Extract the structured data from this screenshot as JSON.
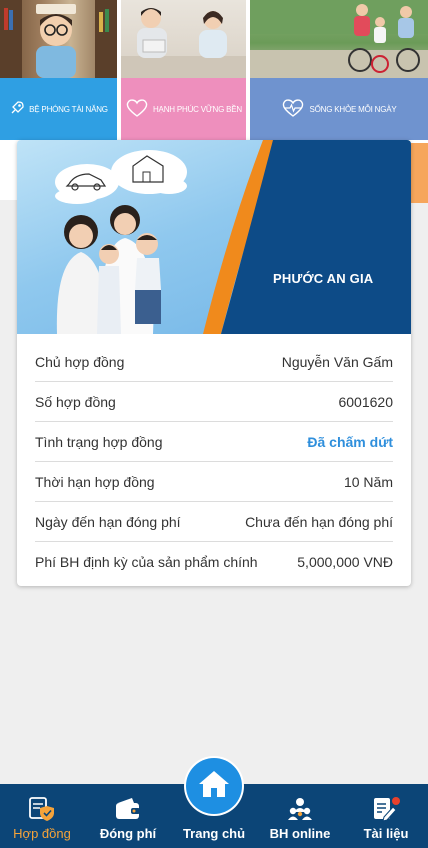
{
  "banners": [
    {
      "label": "BỆ PHÓNG TÀI NĂNG",
      "icon": "rocket-icon",
      "color": "#2f9fe3"
    },
    {
      "label": "HẠNH PHÚC VỮNG BỀN",
      "icon": "heart-icon",
      "color": "#ee8fbd"
    },
    {
      "label": "SỐNG KHỎE MỖI NGÀY",
      "icon": "heart-pulse-icon",
      "color": "#6f93cf"
    }
  ],
  "contract": {
    "product_name": "PHƯỚC AN GIA",
    "rows": [
      {
        "label": "Chủ hợp đồng",
        "value": "Nguyễn Văn Gấm"
      },
      {
        "label": "Số hợp đồng",
        "value": "6001620"
      },
      {
        "label": "Tình trạng hợp đồng",
        "value": "Đã chấm dứt"
      },
      {
        "label": "Thời hạn hợp đồng",
        "value": "10 Năm"
      },
      {
        "label": "Ngày đến hạn đóng phí",
        "value": "Chưa đến hạn đóng phí"
      },
      {
        "label": "Phí BH định kỳ của sản phẩm chính",
        "value": "5,000,000 VNĐ"
      }
    ]
  },
  "bottom_nav": {
    "items": [
      {
        "label": "Hợp đồng",
        "icon": "contract-shield-icon",
        "active": true
      },
      {
        "label": "Đóng phí",
        "icon": "wallet-icon"
      },
      {
        "label": "Trang chủ",
        "icon": "home-icon"
      },
      {
        "label": "BH online",
        "icon": "team-icon"
      },
      {
        "label": "Tài liệu",
        "icon": "document-edit-icon"
      }
    ]
  },
  "colors": {
    "nav_background": "#0c4577",
    "active_tab": "#f5a33a",
    "status_terminated": "#2f8fdc",
    "hero_navy": "#0d4b87",
    "hero_orange": "#f08a1c"
  }
}
